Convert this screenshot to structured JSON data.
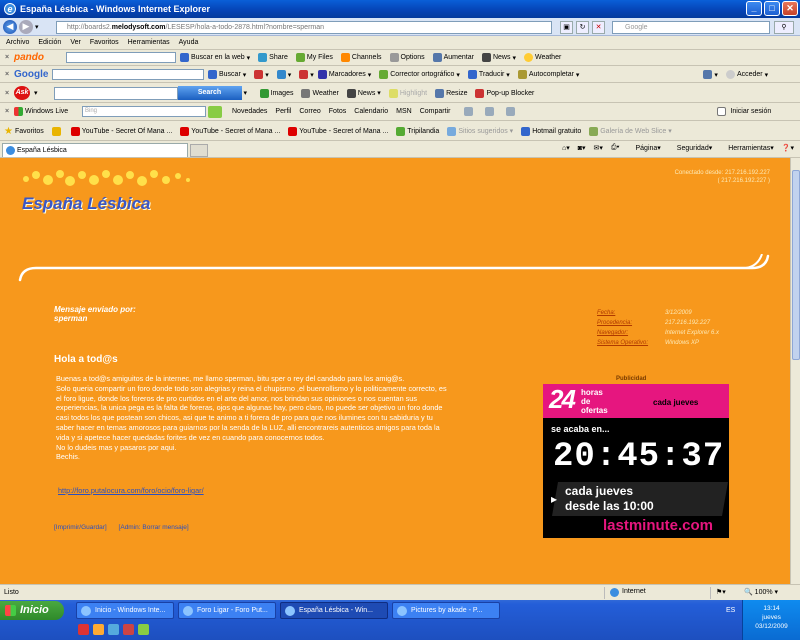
{
  "window": {
    "title": "España Lésbica - Windows Internet Explorer",
    "min": "_",
    "max": "□",
    "close": "✕"
  },
  "address": {
    "url_prefix": "http://boards2.",
    "url_host": "melodysoft.com",
    "url_suffix": "/LESESP/hola-a-todo-2878.html?nombre=sperman",
    "search_placeholder": "Google"
  },
  "menu": [
    "Archivo",
    "Edición",
    "Ver",
    "Favoritos",
    "Herramientas",
    "Ayuda"
  ],
  "pando": {
    "logo": "pando",
    "items": [
      "Buscar en la web",
      "Share",
      "My Files",
      "Channels",
      "Options",
      "Aumentar",
      "News",
      "Weather"
    ]
  },
  "google": {
    "logo": "Google",
    "items": [
      "Buscar",
      "Marcadores",
      "Corrector ortográfico",
      "Traducir",
      "Autocompletar",
      "Acceder"
    ]
  },
  "ask": {
    "logo": "Ask",
    "search": "Search",
    "items": [
      "Highlight",
      "Resize",
      "Pop-up Blocker",
      "Images",
      "Weather",
      "News"
    ]
  },
  "live": {
    "brand": "Windows Live",
    "placeholder": "Bing",
    "items": [
      "Novedades",
      "Perfil",
      "Correo",
      "Fotos",
      "Calendario",
      "MSN",
      "Compartir"
    ],
    "signin": "Iniciar sesión"
  },
  "favbar": {
    "label": "Favoritos",
    "items": [
      "YouTube - Secret Of Mana ...",
      "YouTube - Secret of Mana ...",
      "YouTube - Secret of Mana ...",
      "Tripilandia",
      "Sitios sugeridos",
      "Hotmail gratuito",
      "Galería de Web Slice"
    ]
  },
  "tab": {
    "title": "España Lésbica",
    "tools": [
      "Página",
      "Seguridad",
      "Herramientas"
    ]
  },
  "page": {
    "site": "España Lésbica",
    "connected": "Conectado desde: 217.216.192.227",
    "connected_ip": "( 217.216.192.227 )",
    "sent_by_label": "Mensaje enviado por:",
    "sender": "sperman",
    "meta": [
      {
        "k": "Fecha:",
        "v": "3/12/2009"
      },
      {
        "k": "Procedencia:",
        "v": "217.216.192.227"
      },
      {
        "k": "Navegador:",
        "v": "Internet Explorer 6.x"
      },
      {
        "k": "Sistema Operativo:",
        "v": "Windows XP"
      }
    ],
    "msg_title": "Hola a tod@s",
    "msg_lines": [
      "Buenas a tod@s amiguitos de la internec, me llamo sperman, bitu sper o rey del candado para los amig@s.",
      "Solo queria compartir un foro donde todo son alegrias y reina el chupismo ,el buenrollismo y lo politicamente correcto, es",
      "el foro ligue, donde los foreros de pro curtidos en el arte del amor, nos brindan sus opiniones o nos cuentan sus",
      "experiencias, la unica pega es la falta de foreras, ojos que algunas hay, pero claro, no puede ser objetivo un foro donde",
      "casi todos los que postean son chicos, asi que te animo a ti forera de pro para que nos ilumines con tu sabiduria y tu",
      "saber hacer en temas amorosos para guiarnos por la senda de la LUZ, alli encontrareis autenticos amigos para toda la",
      "vida y si apetece hacer quedadas forites de vez en cuando para conocernos todos.",
      "No lo dudeis mas y pasaros por aqui.",
      "Bechis."
    ],
    "link": "http://foro.putalocura.com/foro/ocio/foro-ligar/",
    "actions": [
      "[Imprimir/Guardar]",
      "[Admin: Borrar mensaje]"
    ],
    "ad_label": "Publicidad"
  },
  "ad": {
    "num": "24",
    "h1": "horas",
    "h2": "de",
    "h3": "ofertas",
    "cada_top": "cada jueves",
    "acaba": "se acaba en...",
    "clock": "20:45:37",
    "cada": "cada jueves",
    "desde": "desde las 10:00",
    "brand": "lastminute.com"
  },
  "status": {
    "left": "Listo",
    "zone": "Internet",
    "zoom": "100%"
  },
  "taskbar": {
    "start": "Inicio",
    "tasks": [
      "Inicio - Windows Inte...",
      "Foro Ligar - Foro Put...",
      "España Lésbica - Win...",
      "Pictures by akade - P..."
    ],
    "lang": "ES",
    "time": "13:14",
    "day": "jueves",
    "date": "03/12/2009"
  }
}
